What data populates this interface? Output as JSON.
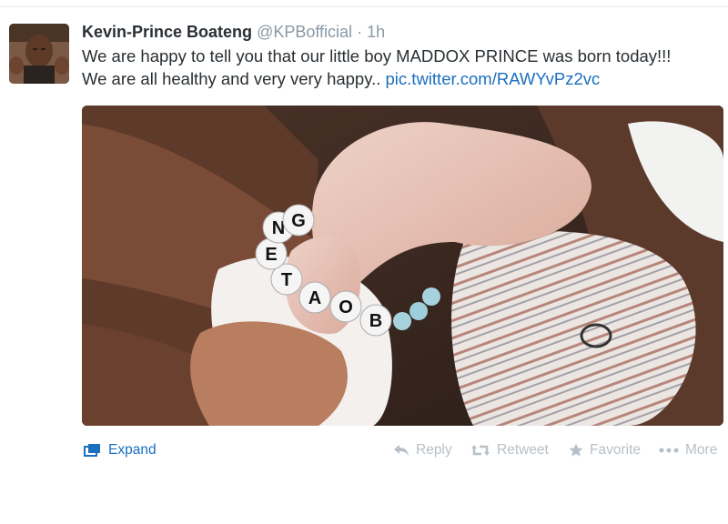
{
  "tweet": {
    "author_name": "Kevin-Prince Boateng",
    "author_handle": "@KPBofficial",
    "separator": "·",
    "timestamp": "1h",
    "text_line1": "We are happy to tell you that our little boy MADDOX PRINCE was born today!!!",
    "text_line2": "We are all healthy and very very happy..",
    "link_text": "pic.twitter.com/RAWYvPz2vc",
    "photo_letters": [
      "B",
      "O",
      "A",
      "T",
      "E",
      "N",
      "G"
    ]
  },
  "actions": {
    "expand": "Expand",
    "reply": "Reply",
    "retweet": "Retweet",
    "favorite": "Favorite",
    "more": "More"
  },
  "colors": {
    "link": "#1b6fbf",
    "muted": "#8899a6",
    "action_disabled": "#b8c0c7",
    "text": "#292f33"
  },
  "icons": {
    "expand": "expand-icon",
    "reply": "reply-icon",
    "retweet": "retweet-icon",
    "favorite": "star-icon",
    "more": "more-dots-icon"
  }
}
